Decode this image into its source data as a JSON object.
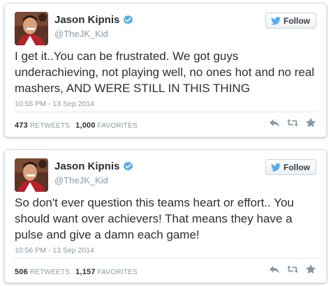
{
  "colors": {
    "verified": "#55acee",
    "twitter_blue": "#55acee",
    "text": "#292f33",
    "muted": "#8899a6",
    "action_icon": "#8899a6"
  },
  "icons": {
    "verified": "verified-badge-icon",
    "follow": "twitter-bird-icon",
    "reply": "reply-icon",
    "retweet": "retweet-icon",
    "favorite": "star-icon"
  },
  "tweets": [
    {
      "user_name": "Jason Kipnis",
      "handle": "@TheJK_Kid",
      "follow_label": "Follow",
      "text": "I get it..You can be frustrated. We got guys underachieving, not playing well, no ones hot and no real mashers, AND WERE STILL IN THIS THING",
      "timestamp": "10:55 PM - 13 Sep 2014",
      "retweets": "473",
      "retweets_label": "RETWEETS",
      "favorites": "1,000",
      "favorites_label": "FAVORITES"
    },
    {
      "user_name": "Jason Kipnis",
      "handle": "@TheJK_Kid",
      "follow_label": "Follow",
      "text": "So don't ever question this teams heart or effort.. You should want over achievers! That means they have a pulse and give a damn each game!",
      "timestamp": "10:56 PM - 13 Sep 2014",
      "retweets": "506",
      "retweets_label": "RETWEETS",
      "favorites": "1,157",
      "favorites_label": "FAVORITES"
    }
  ]
}
